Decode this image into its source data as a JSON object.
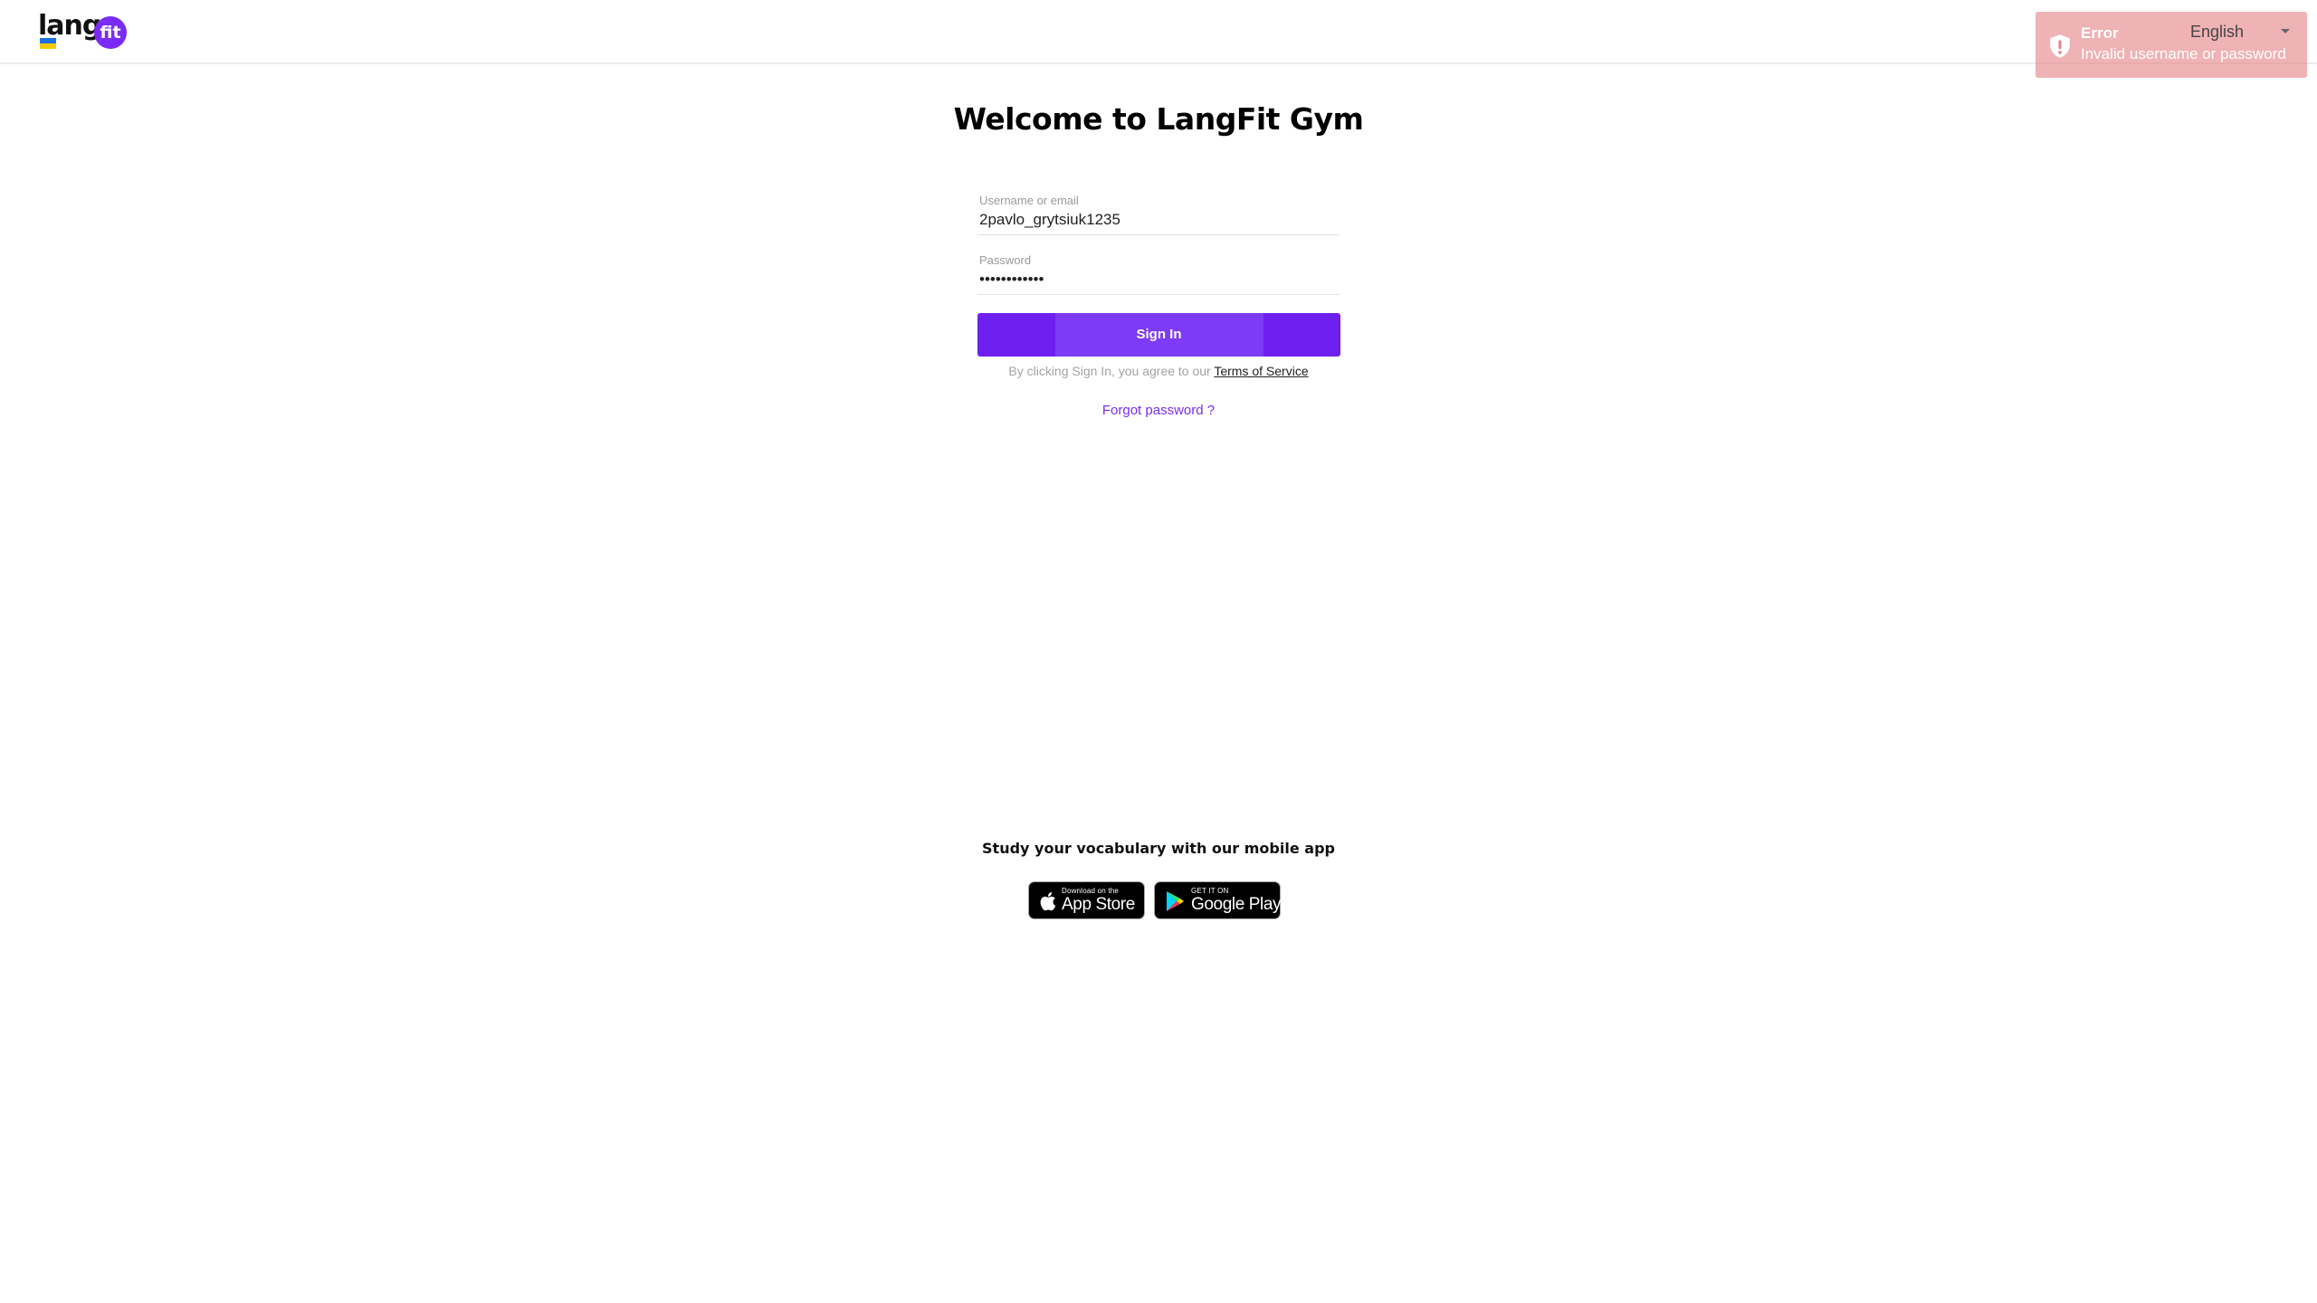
{
  "header": {
    "logo_text": "lang",
    "logo_badge": "fit",
    "language": "English",
    "language_icon": "chevron-down-icon"
  },
  "toast": {
    "title": "Error",
    "message": "Invalid username or password",
    "icon": "shield-icon",
    "background": "#e58287"
  },
  "form": {
    "title": "Welcome to LangFit Gym",
    "username_label": "Username or email",
    "username_value": "2pavlo_grytsiuk1235",
    "password_label": "Password",
    "password_value": "••••••••••••",
    "signin_label": "Sign In",
    "agree_text": "By clicking Sign In, you agree to our ",
    "terms_link": "Terms of Service",
    "forgot_link": "Forgot password ?"
  },
  "promo": {
    "heading": "Study your vocabulary with our mobile app",
    "app_store": {
      "small": "Download on the",
      "big": "App Store",
      "icon": "apple-icon"
    },
    "google_play": {
      "small": "GET IT ON",
      "big": "Google Play",
      "icon": "google-play-icon"
    }
  },
  "colors": {
    "accent": "#6f1ff0",
    "link": "#7a2cf6",
    "error": "#e58287"
  }
}
